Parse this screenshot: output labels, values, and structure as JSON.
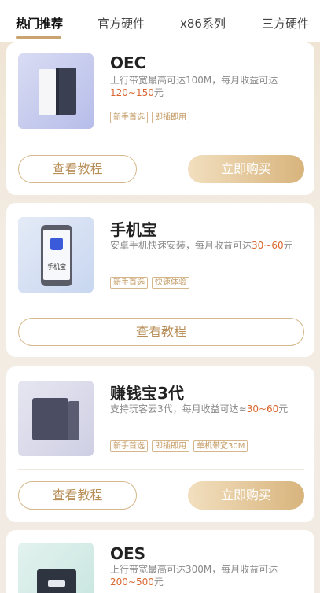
{
  "tabs": [
    {
      "label": "热门推荐",
      "active": true
    },
    {
      "label": "官方硬件",
      "active": false
    },
    {
      "label": "x86系列",
      "active": false
    },
    {
      "label": "三方硬件",
      "active": false
    }
  ],
  "cards": [
    {
      "title": "OEC",
      "desc_text": "上行带宽最高可达100M，每月收益可达",
      "desc_highlight": "120~150",
      "desc_suffix": "元",
      "tags": [
        "新手首选",
        "即插即用"
      ],
      "tutorial_label": "查看教程",
      "buy_label": "立即购买"
    },
    {
      "title": "手机宝",
      "desc_text": "安卓手机快速安装，每月收益可达",
      "desc_highlight": "30~60",
      "desc_suffix": "元",
      "tags": [
        "新手首选",
        "快速体验"
      ],
      "tutorial_label": "查看教程",
      "thumb_label": "手机宝"
    },
    {
      "title": "赚钱宝3代",
      "desc_text": "支持玩客云3代，每月收益可达≈",
      "desc_highlight": "30~60",
      "desc_suffix": "元",
      "tags": [
        "新手首选",
        "即插即用",
        "单机带宽30M"
      ],
      "tutorial_label": "查看教程",
      "buy_label": "立即购买"
    },
    {
      "title": "OES",
      "desc_text": "上行带宽最高可达300M，每月收益可达",
      "desc_highlight": "200~500",
      "desc_suffix": "元"
    }
  ],
  "colors": {
    "accent": "#c9a46e",
    "highlight": "#d9662f",
    "tag_border": "#d6b78b"
  }
}
